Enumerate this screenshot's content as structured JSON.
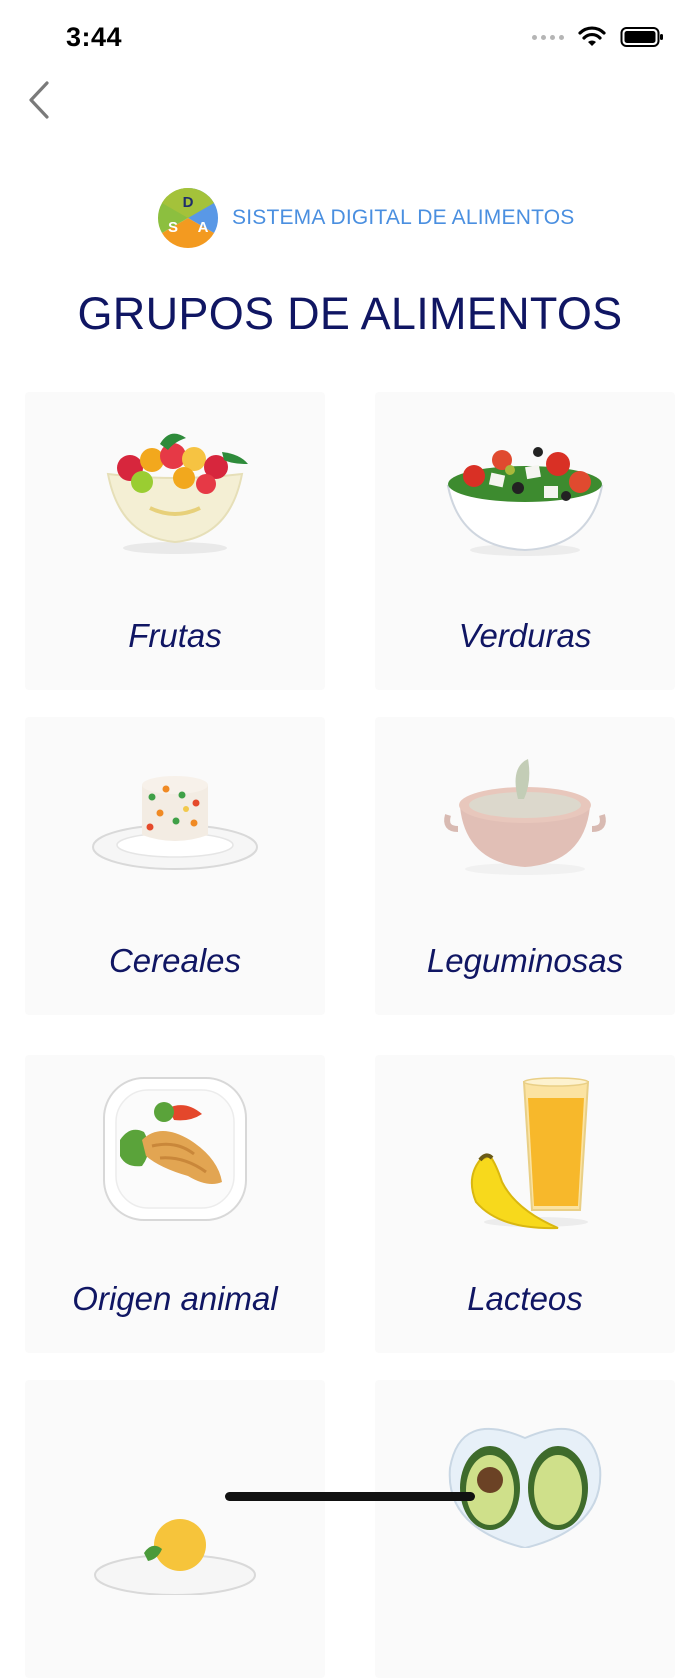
{
  "status_bar": {
    "time": "3:44"
  },
  "brand": {
    "logo_letters": {
      "top": "D",
      "left": "S",
      "right": "A"
    },
    "name": "SISTEMA DIGITAL DE ALIMENTOS"
  },
  "page": {
    "title": "GRUPOS DE ALIMENTOS"
  },
  "groups": [
    {
      "label": "Frutas",
      "icon": "fruit-salad-icon"
    },
    {
      "label": "Verduras",
      "icon": "vegetable-salad-icon"
    },
    {
      "label": "Cereales",
      "icon": "rice-plate-icon"
    },
    {
      "label": "Leguminosas",
      "icon": "lentil-pot-icon"
    },
    {
      "label": "Origen animal",
      "icon": "chicken-plate-icon"
    },
    {
      "label": "Lacteos",
      "icon": "juice-banana-icon"
    },
    {
      "label": "",
      "icon": "ice-cream-plate-icon"
    },
    {
      "label": "",
      "icon": "avocado-plate-icon"
    }
  ],
  "colors": {
    "title": "#101663",
    "brand_text": "#4a8fe0",
    "card_bg": "#fafafa"
  }
}
